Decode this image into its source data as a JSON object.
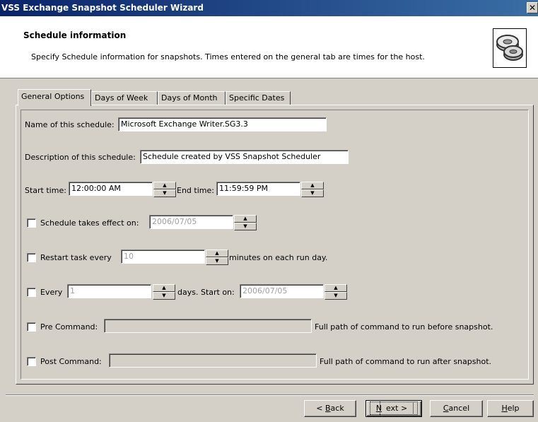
{
  "window": {
    "title": "VSS Exchange Snapshot Scheduler Wizard",
    "close_glyph": "✕"
  },
  "header": {
    "title": "Schedule information",
    "description": "Specify Schedule information for snapshots. Times entered on the general tab are times for the host.",
    "icon": "snapshot-disks-icon"
  },
  "tabs": [
    {
      "label": "General Options",
      "active": true
    },
    {
      "label": "Days of Week",
      "active": false
    },
    {
      "label": "Days of Month",
      "active": false
    },
    {
      "label": "Specific Dates",
      "active": false
    }
  ],
  "general": {
    "name_label": "Name of this schedule:",
    "name_value": "Microsoft Exchange Writer.SG3.3",
    "description_label": "Description of this schedule:",
    "description_value": "Schedule created by VSS Snapshot Scheduler",
    "start_time_label": "Start time:",
    "start_time_value": "12:00:00 AM",
    "end_time_label": "End time:",
    "end_time_value": "11:59:59 PM",
    "effect_label": "Schedule takes effect on:",
    "effect_value": "2006/07/05",
    "effect_checked": false,
    "restart_label": "Restart task every",
    "restart_value": "10",
    "restart_suffix": "minutes on each run day.",
    "restart_checked": false,
    "every_label": "Every",
    "every_value": "1",
    "every_suffix": "days. Start on:",
    "every_start_value": "2006/07/05",
    "every_checked": false,
    "pre_label": "Pre Command:",
    "pre_value": "",
    "pre_hint": "Full path of command to run before snapshot.",
    "pre_checked": false,
    "post_label": "Post Command:",
    "post_value": "",
    "post_hint": "Full path of command to run after snapshot.",
    "post_checked": false
  },
  "buttons": {
    "back": {
      "pre": "< ",
      "ul": "B",
      "post": "ack"
    },
    "next": {
      "pre": "",
      "ul": "N",
      "post": "ext >"
    },
    "cancel": {
      "pre": "",
      "ul": "C",
      "post": "ancel"
    },
    "help": {
      "pre": "",
      "ul": "H",
      "post": "elp"
    }
  },
  "spin_glyphs": {
    "up": "▲",
    "down": "▼"
  }
}
